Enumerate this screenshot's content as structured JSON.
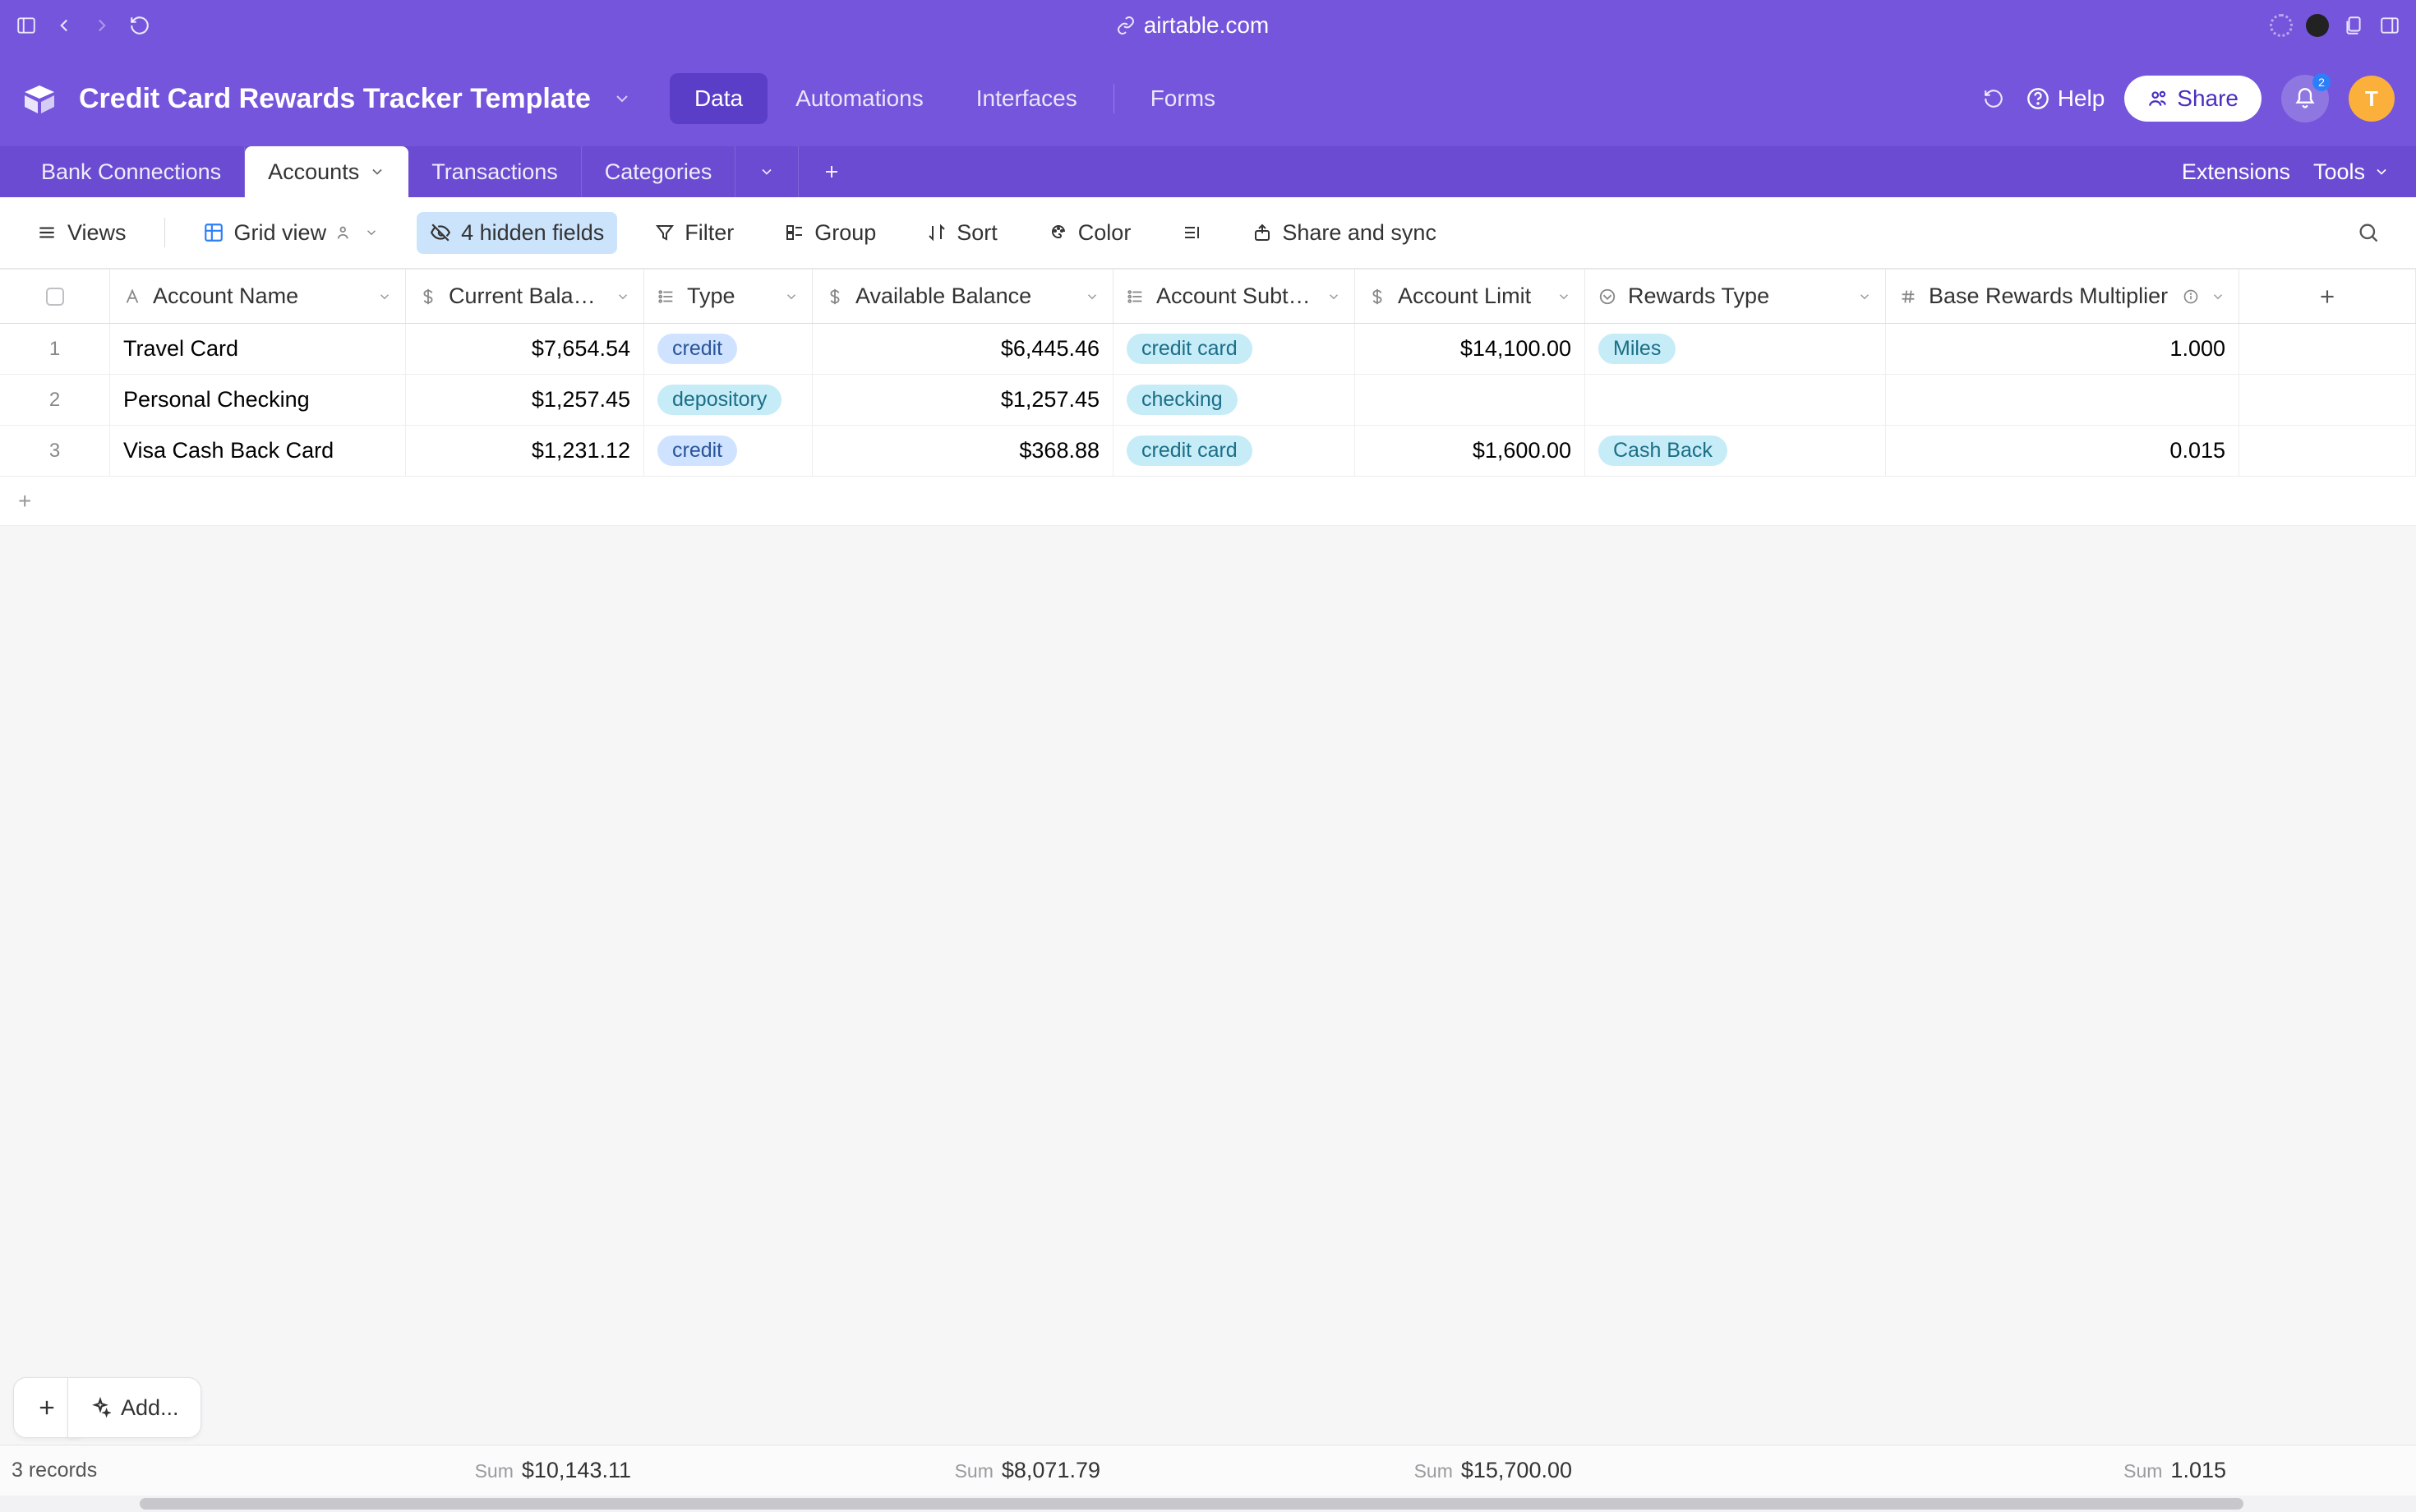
{
  "browser": {
    "url": "airtable.com"
  },
  "base": {
    "title": "Credit Card Rewards Tracker Template"
  },
  "nav": {
    "data": "Data",
    "automations": "Automations",
    "interfaces": "Interfaces",
    "forms": "Forms"
  },
  "top_actions": {
    "help": "Help",
    "share": "Share",
    "notification_count": "2",
    "avatar_initial": "T"
  },
  "table_tabs": {
    "items": [
      "Bank Connections",
      "Accounts",
      "Transactions",
      "Categories"
    ],
    "extensions": "Extensions",
    "tools": "Tools"
  },
  "toolbar": {
    "views": "Views",
    "grid_view": "Grid view",
    "hidden_fields": "4 hidden fields",
    "filter": "Filter",
    "group": "Group",
    "sort": "Sort",
    "color": "Color",
    "share_sync": "Share and sync"
  },
  "columns": {
    "account_name": "Account Name",
    "current_balance": "Current Balan…",
    "type": "Type",
    "available_balance": "Available Balance",
    "account_subtype": "Account Subty…",
    "account_limit": "Account Limit",
    "rewards_type": "Rewards Type",
    "base_multiplier": "Base Rewards Multiplier"
  },
  "rows": [
    {
      "n": "1",
      "name": "Travel Card",
      "bal": "$7,654.54",
      "type": "credit",
      "avail": "$6,445.46",
      "sub": "credit card",
      "limit": "$14,100.00",
      "reward": "Miles",
      "mult": "1.000"
    },
    {
      "n": "2",
      "name": "Personal Checking",
      "bal": "$1,257.45",
      "type": "depository",
      "avail": "$1,257.45",
      "sub": "checking",
      "limit": "",
      "reward": "",
      "mult": ""
    },
    {
      "n": "3",
      "name": "Visa Cash Back Card",
      "bal": "$1,231.12",
      "type": "credit",
      "avail": "$368.88",
      "sub": "credit card",
      "limit": "$1,600.00",
      "reward": "Cash Back",
      "mult": "0.015"
    }
  ],
  "summary": {
    "records": "3 records",
    "sum_label": "Sum",
    "bal": "$10,143.11",
    "avail": "$8,071.79",
    "limit": "$15,700.00",
    "mult": "1.015"
  },
  "bottom": {
    "add": "Add..."
  },
  "pill_colors": {
    "credit": "blue",
    "depository": "cyan",
    "credit card": "cyan",
    "checking": "cyan",
    "Miles": "cyan",
    "Cash Back": "cyan"
  }
}
